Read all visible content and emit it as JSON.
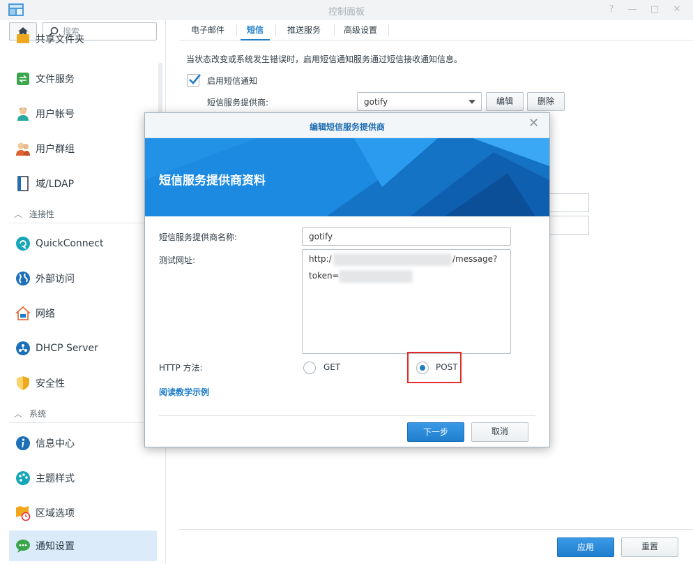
{
  "window": {
    "title": "控制面板"
  },
  "sidebar": {
    "search_placeholder": "搜索",
    "partial_item": "共享文件夹",
    "items": [
      {
        "label": "文件服务"
      },
      {
        "label": "用户帐号"
      },
      {
        "label": "用户群组"
      },
      {
        "label": "域/LDAP"
      }
    ],
    "section_connectivity": "连接性",
    "connectivity_items": [
      {
        "label": "QuickConnect"
      },
      {
        "label": "外部访问"
      },
      {
        "label": "网络"
      },
      {
        "label": "DHCP Server"
      },
      {
        "label": "安全性"
      }
    ],
    "section_system": "系统",
    "system_items": [
      {
        "label": "信息中心"
      },
      {
        "label": "主题样式"
      },
      {
        "label": "区域选项"
      },
      {
        "label": "通知设置"
      }
    ]
  },
  "tabs": [
    {
      "label": "电子邮件"
    },
    {
      "label": "短信"
    },
    {
      "label": "推送服务"
    },
    {
      "label": "高级设置"
    }
  ],
  "sms": {
    "description": "当状态改变或系统发生错误时，启用短信通知服务通过短信接收通知信息。",
    "enable_label": "启用短信通知",
    "enable_checked": true,
    "provider_label": "短信服务提供商:",
    "provider_value": "gotify",
    "edit_button": "编辑",
    "delete_button": "删除"
  },
  "footer": {
    "apply_button": "应用",
    "reset_button": "重置"
  },
  "modal": {
    "title": "编辑短信服务提供商",
    "banner_title": "短信服务提供商资料",
    "name_label": "短信服务提供商名称:",
    "name_value": "gotify",
    "url_label": "测试网址:",
    "url_line1_start": "http:/",
    "url_line1_end": "/message?",
    "url_line2_start": "token=",
    "method_label": "HTTP 方法:",
    "method_get": "GET",
    "method_post": "POST",
    "selected_method": "POST",
    "tutorial_link": "阅读教学示例",
    "next_button": "下一步",
    "cancel_button": "取消"
  },
  "colors": {
    "accent": "#1d7dc9",
    "highlight": "#e52a2a",
    "banner": "#1a86db"
  }
}
